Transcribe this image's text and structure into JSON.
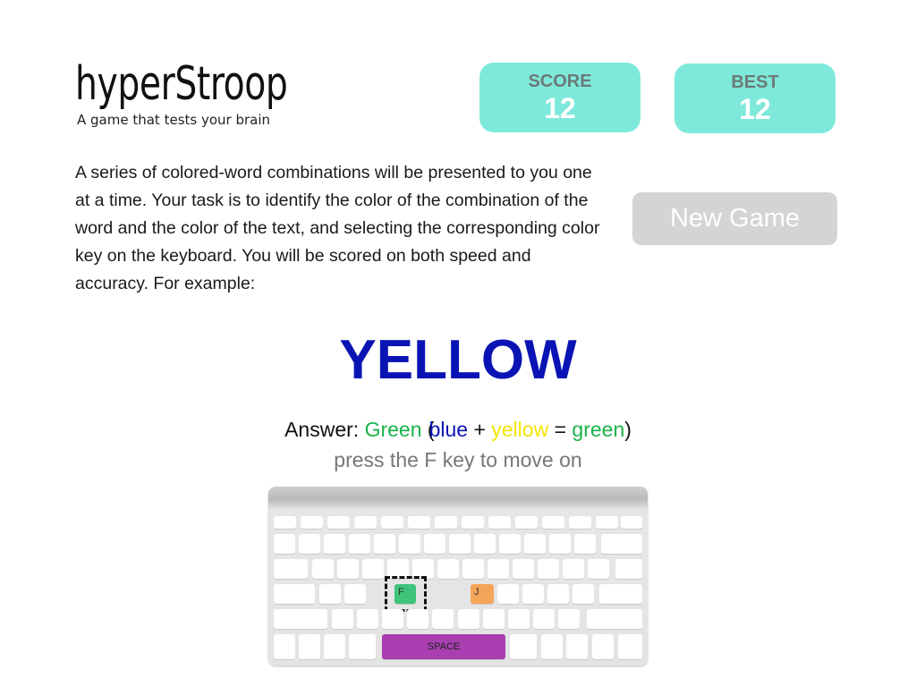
{
  "brand": {
    "title": "hyperStroop",
    "subtitle": "A game that tests your brain"
  },
  "score": {
    "label": "SCORE",
    "value": "12"
  },
  "best": {
    "label": "BEST",
    "value": "12"
  },
  "new_game_label": "New Game",
  "instructions": "A series of colored-word combinations will be presented to you one at a time. Your task is to identify the color of the combination of the word and the color of the text, and selecting the corresponding color key on the keyboard. You will be scored on both speed and accuracy. For example:",
  "example": {
    "word": "YELLOW",
    "word_color": "#0a14b4",
    "answer_prefix": "Answer:",
    "answer_value": "Green",
    "paren_open": "(",
    "term1": "blue",
    "plus": "+",
    "term2": "yellow",
    "equals": "=",
    "result": "green",
    "paren_close": ")",
    "hint": "press the F key to move on"
  },
  "colors": {
    "green": "#1bb34a",
    "blue": "#0a14b4",
    "yellow": "#f4e400",
    "accent_box": "#7ee9da",
    "key_f": "#3ec47a",
    "key_j": "#f5a55a",
    "key_space": "#a83eb0"
  },
  "keyboard": {
    "key_f": "F",
    "key_j": "J",
    "space": "SPACE"
  }
}
